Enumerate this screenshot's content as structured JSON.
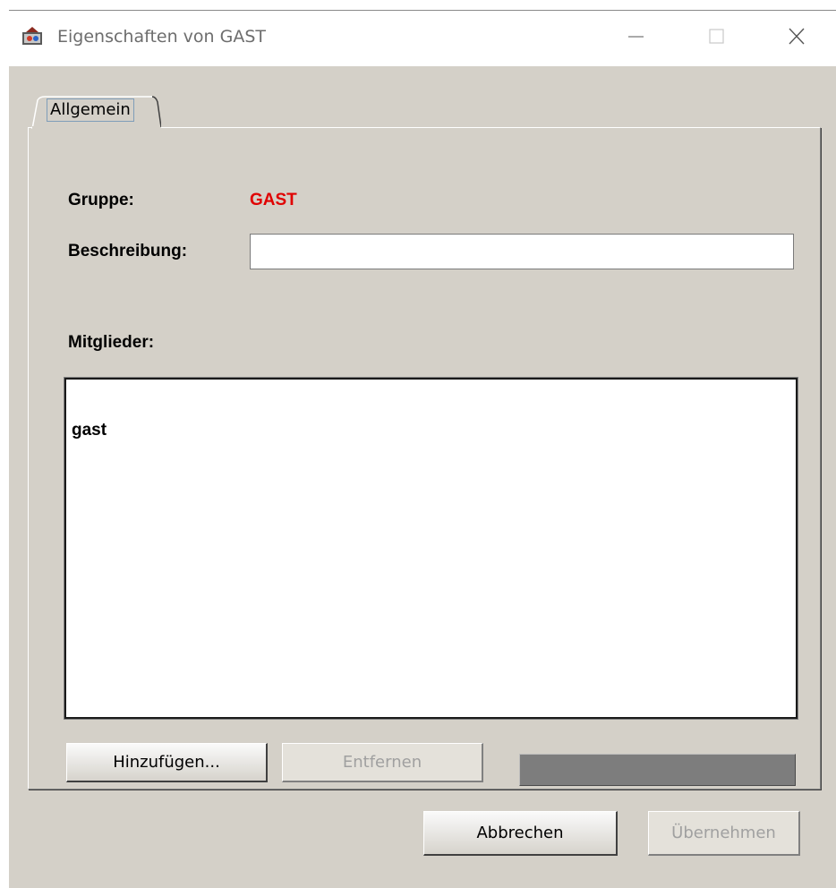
{
  "window": {
    "title": "Eigenschaften von GAST",
    "icon": "app-icon",
    "controls": {
      "minimize_icon": "minimize-icon",
      "maximize_icon": "maximize-icon",
      "close_icon": "close-icon"
    }
  },
  "tabs": [
    {
      "label": "Allgemein",
      "selected": true
    }
  ],
  "form": {
    "group_label": "Gruppe:",
    "group_value": "GAST",
    "group_value_color": "#e00000",
    "description_label": "Beschreibung:",
    "description_value": "",
    "members_label": "Mitglieder:",
    "members": [
      "gast"
    ]
  },
  "buttons": {
    "add": "Hinzufügen...",
    "remove": "Entfernen",
    "cancel": "Abbrechen",
    "apply": "Übernehmen"
  }
}
